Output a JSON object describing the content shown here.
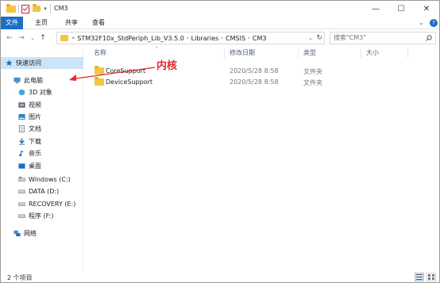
{
  "window": {
    "title": "CM3",
    "controls": {
      "minimize": "—",
      "maximize": "☐",
      "close": "✕"
    }
  },
  "ribbon": {
    "tabs": [
      "文件",
      "主页",
      "共享",
      "查看"
    ],
    "expand_glyph": "⌄",
    "help_glyph": "?"
  },
  "nav": {
    "back": "←",
    "forward": "→",
    "recent": "⌄",
    "up": "↑",
    "prefix": "«",
    "breadcrumbs": [
      "STM32F10x_StdPeriph_Lib_V3.5.0",
      "Libraries",
      "CMSIS",
      "CM3"
    ],
    "refresh": "↻",
    "search_placeholder": "搜索\"CM3\""
  },
  "sidebar": {
    "items": [
      {
        "label": "快速访问",
        "icon": "star-icon"
      },
      {
        "label": "此电脑",
        "icon": "computer-icon"
      },
      {
        "label": "3D 对象",
        "icon": "cube-icon"
      },
      {
        "label": "视频",
        "icon": "video-icon"
      },
      {
        "label": "图片",
        "icon": "image-icon"
      },
      {
        "label": "文档",
        "icon": "document-icon"
      },
      {
        "label": "下载",
        "icon": "download-icon"
      },
      {
        "label": "音乐",
        "icon": "music-icon"
      },
      {
        "label": "桌面",
        "icon": "desktop-icon"
      },
      {
        "label": "Windows (C:)",
        "icon": "drive-icon"
      },
      {
        "label": "DATA (D:)",
        "icon": "drive-icon"
      },
      {
        "label": "RECOVERY (E:)",
        "icon": "drive-icon"
      },
      {
        "label": "程序 (F:)",
        "icon": "drive-icon"
      },
      {
        "label": "网络",
        "icon": "network-icon"
      }
    ]
  },
  "columns": [
    "名称",
    "修改日期",
    "类型",
    "大小"
  ],
  "files": [
    {
      "name": "CoreSupport",
      "date": "2020/5/28 8:58",
      "type": "文件夹",
      "size": ""
    },
    {
      "name": "DeviceSupport",
      "date": "2020/5/28 8:58",
      "type": "文件夹",
      "size": ""
    }
  ],
  "annotation": {
    "text": "内核",
    "color": "#e3262c"
  },
  "status": {
    "count": "2 个项目"
  },
  "colors": {
    "accent": "#1a6fc7",
    "selection": "#cce4f7",
    "folder": "#f4c542"
  }
}
